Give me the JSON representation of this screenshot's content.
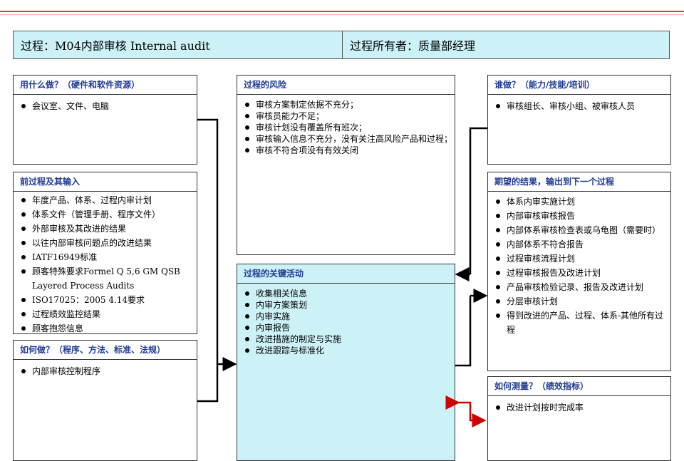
{
  "header": {
    "process": "过程：M04内部审核 Internal audit",
    "owner": "过程所有者：质量部经理"
  },
  "resources": {
    "title": "用什么做？（硬件和软件资源）",
    "items": [
      "会议室、文件、电脑"
    ]
  },
  "risks": {
    "title": "过程的风险",
    "items": [
      "审核方案制定依据不充分；",
      "审核员能力不足；",
      "审核计划没有覆盖所有班次；",
      "审核输入信息不充分，没有关注高风险产品和过程；",
      "审核不符合项没有有效关闭"
    ]
  },
  "who": {
    "title": "谁做？（能力/技能/培训）",
    "items": [
      "审核组长、审核小组、被审核人员"
    ]
  },
  "inputs": {
    "title": "前过程及其输入",
    "items": [
      "年度产品、体系、过程内审计划",
      "体系文件（管理手册、程序文件）",
      "外部审核及其改进的结果",
      "以往内部审核问题点的改进结果",
      "IATF16949标准",
      "顾客特殊要求Formel  Q 5,6 GM QSB Layered Process Audits",
      "ISO17025：2005   4.14要求",
      "过程绩效监控结果",
      "顾客抱怨信息"
    ]
  },
  "outputs": {
    "title": "期望的结果，输出到下一个过程",
    "items": [
      "体系内审实施计划",
      "内部审核审核报告",
      "内部体系审核检查表或乌龟图（需要时）",
      "内部体系不符合报告",
      "过程审核流程计划",
      "过程审核报告及改进计划",
      "产品审核检验记录、报告及改进计划",
      "分层审核计划",
      "得到改进的产品、过程、体系-其他所有过程"
    ]
  },
  "activities": {
    "title": "过程的关键活动",
    "items": [
      "收集相关信息",
      "内审方案策划",
      "内审实施",
      "内审报告",
      "改进措施的制定与实施",
      "改进跟踪与标准化"
    ]
  },
  "how": {
    "title": "如何做？（程序、方法、标准、法规）",
    "items": [
      "内部审核控制程序"
    ]
  },
  "measure": {
    "title": "如何测量？（绩效指标）",
    "items": [
      "改进计划按时完成率"
    ]
  },
  "colors": {
    "header_bg": "#ccf2f8",
    "activity_bg": "#ccf2f8",
    "title_text": "#1f3a93",
    "measure_arrow": "#d00000"
  }
}
